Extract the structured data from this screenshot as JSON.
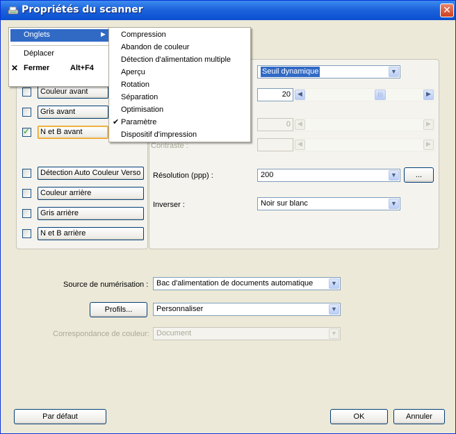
{
  "window": {
    "title": "Propriétés du scanner",
    "close_glyph": "✕"
  },
  "left_checks": [
    {
      "label": "Couleur avant",
      "checked": false
    },
    {
      "label": "Gris avant",
      "checked": false
    },
    {
      "label": "N et B avant",
      "checked": true
    },
    {
      "label": "Détection Auto Couleur Verso",
      "checked": false
    },
    {
      "label": "Couleur arrière",
      "checked": false
    },
    {
      "label": "Gris arrière",
      "checked": false
    },
    {
      "label": "N et B arrière",
      "checked": false
    }
  ],
  "settings": {
    "threshold_mode": "Seuil dynamique",
    "threshold_value": "20",
    "brightness_value": "0",
    "contrast_label": "Contraste :",
    "resolution_label": "Résolution (ppp) :",
    "resolution_value": "200",
    "resolution_more": "...",
    "invert_label": "Inverser :",
    "invert_value": "Noir sur blanc"
  },
  "source": {
    "label": "Source de numérisation :",
    "value": "Bac d'alimentation de documents automatique"
  },
  "profiles": {
    "button": "Profils...",
    "value": "Personnaliser"
  },
  "color_match": {
    "label": "Correspondance de couleur:",
    "value": "Document"
  },
  "buttons": {
    "default": "Par défaut",
    "ok": "OK",
    "cancel": "Annuler"
  },
  "system_menu": {
    "tabs": "Onglets",
    "move": "Déplacer",
    "close": "Fermer",
    "close_shortcut": "Alt+F4"
  },
  "submenu": [
    {
      "label": "Compression",
      "checked": false
    },
    {
      "label": "Abandon de couleur",
      "checked": false
    },
    {
      "label": "Détection d'alimentation multiple",
      "checked": false
    },
    {
      "label": "Aperçu",
      "checked": false
    },
    {
      "label": "Rotation",
      "checked": false
    },
    {
      "label": "Séparation",
      "checked": false
    },
    {
      "label": "Optimisation",
      "checked": false
    },
    {
      "label": "Paramètre",
      "checked": true
    },
    {
      "label": "Dispositif d'impression",
      "checked": false
    }
  ],
  "colors": {
    "title_bar": "#0a4fd0",
    "menu_highlight": "#316ac5"
  }
}
